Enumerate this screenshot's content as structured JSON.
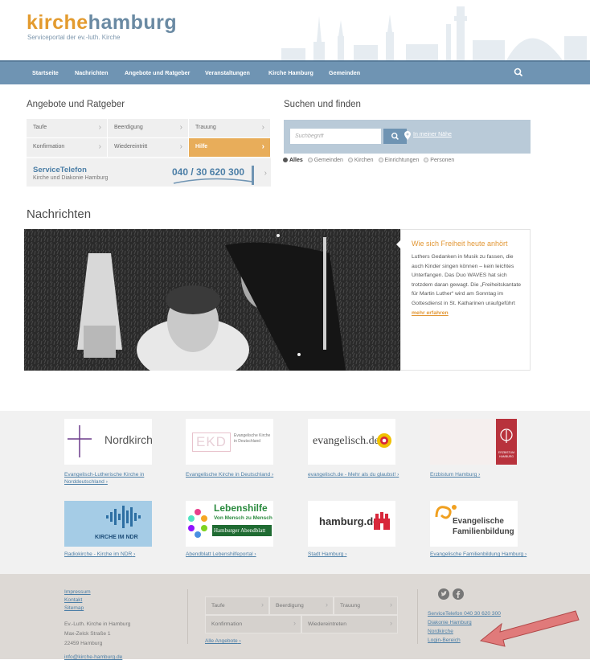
{
  "header": {
    "logo_part1": "kirche",
    "logo_part2": "hamburg",
    "tagline": "Serviceportal der ev.-luth. Kirche"
  },
  "nav": {
    "items": [
      "Startseite",
      "Nachrichten",
      "Angebote und Ratgeber",
      "Veranstaltungen",
      "Kirche Hamburg",
      "Gemeinden"
    ],
    "search_icon": "search-icon"
  },
  "angebote": {
    "title": "Angebote und Ratgeber",
    "cells": [
      "Taufe",
      "Beerdigung",
      "Trauung",
      "Konfirmation",
      "Wiedereintritt",
      "Hilfe"
    ],
    "service_title": "ServiceTelefon",
    "service_sub": "Kirche und Diakonie Hamburg",
    "service_number": "040 / 30 620 300"
  },
  "search": {
    "title": "Suchen und finden",
    "placeholder": "Suchbegriff",
    "near_label": "In meiner Nähe",
    "radios": [
      "Alles",
      "Gemeinden",
      "Kirchen",
      "Einrichtungen",
      "Personen"
    ]
  },
  "news": {
    "title": "Nachrichten",
    "teaser_title": "Wie sich Freiheit heute anhört",
    "teaser_text": "Luthers Gedanken in Musik zu fassen, die auch Kinder singen können – kein leichtes Unterfangen. Das Duo WAVES hat sich trotzdem daran gewagt. Die „Freiheitskantate für Martin Luther“ wird am Sonntag im Gottesdienst in St. Katharinen uraufgeführt",
    "more_label": "mehr erfahren"
  },
  "partners": [
    {
      "logo": "Nordkirche",
      "link1": "Evangelisch-Lutherische Kirche in",
      "link2": "Norddeutschland"
    },
    {
      "logo": "EKD",
      "logo_sub": "Evangelische Kirche in Deutschland",
      "link1": "Evangelische Kirche in Deutschland",
      "link2": ""
    },
    {
      "logo": "evangelisch.de",
      "link1": "evangelisch.de - Mehr als du glaubst!",
      "link2": ""
    },
    {
      "logo_sub": "ERZBISTUM HAMBURG",
      "link1": "Erzbistum Hamburg",
      "link2": ""
    },
    {
      "logo": "KIRCHE IM NDR",
      "link1": "Radiokirche - Kirche im NDR",
      "link2": ""
    },
    {
      "logo": "Lebenshilfe",
      "logo_sub": "Von Mensch zu Mensch",
      "logo_sub2": "Hamburger Abendblatt",
      "link1": "Abendblatt Lebenshilfeportal",
      "link2": ""
    },
    {
      "logo": "hamburg.de",
      "link1": "Stadt Hamburg",
      "link2": ""
    },
    {
      "logo": "Evangelische",
      "logo_sub": "Familienbildung",
      "link1": "Evangelische Familienbildung Hamburg",
      "link2": ""
    }
  ],
  "footer": {
    "links_left": [
      "Impressum",
      "Kontakt",
      "Sitemap"
    ],
    "address": [
      "Ev.-Luth. Kirche in Hamburg",
      "Max-Zelck Straße 1",
      "22459 Hamburg"
    ],
    "email": "info@kirche-hamburg.de",
    "cells": [
      "Taufe",
      "Beerdigung",
      "Trauung",
      "Konfirmation",
      "Wiedereintreten"
    ],
    "all_offers": "Alle Angebote",
    "links_right": [
      "ServiceTelefon 040 30 620 300",
      "Diakonie Hamburg",
      "Nordkirche",
      "Login-Bereich"
    ],
    "social": [
      "twitter-icon",
      "facebook-icon"
    ],
    "annotation_color": "#e07a7a"
  }
}
